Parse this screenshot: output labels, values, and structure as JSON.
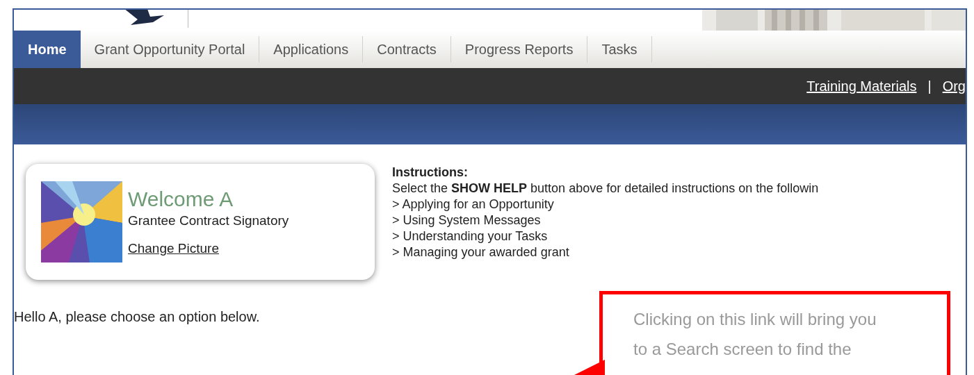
{
  "tabs": [
    {
      "label": "Home",
      "selected": true
    },
    {
      "label": "Grant Opportunity Portal",
      "selected": false
    },
    {
      "label": "Applications",
      "selected": false
    },
    {
      "label": "Contracts",
      "selected": false
    },
    {
      "label": "Progress Reports",
      "selected": false
    },
    {
      "label": "Tasks",
      "selected": false
    }
  ],
  "utility_links": [
    "Training Materials",
    "|",
    "Org"
  ],
  "welcome": {
    "title": "Welcome A",
    "role": "Grantee Contract Signatory",
    "change_picture": "Change Picture"
  },
  "instructions": {
    "heading": "Instructions:",
    "intro": "Select the **SHOW HELP** button above for detailed instructions on the followin",
    "items": [
      "> Applying for an Opportunity",
      "> Using System Messages",
      "> Understanding your Tasks",
      "> Managing your awarded grant"
    ]
  },
  "greeting": "Hello A, please choose an option below.",
  "callout": {
    "lines": [
      "Clicking on this link will bring you",
      "to a Search screen to find the"
    ]
  }
}
